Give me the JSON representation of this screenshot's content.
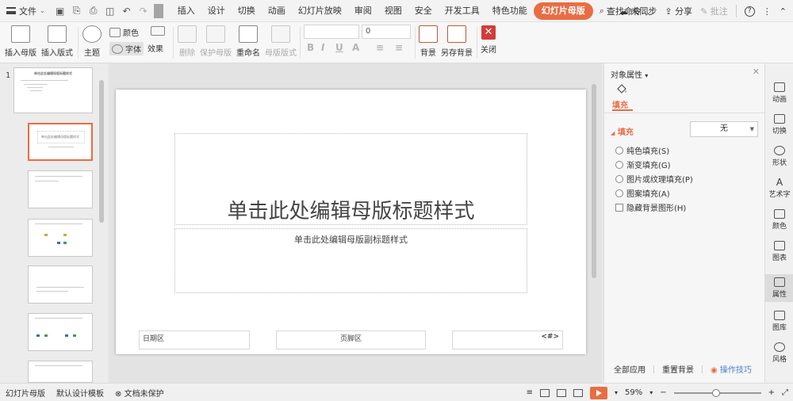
{
  "menubar": {
    "file_label": "文件",
    "tabs": [
      "插入",
      "设计",
      "切换",
      "动画",
      "幻灯片放映",
      "审阅",
      "视图",
      "安全",
      "开发工具",
      "特色功能",
      "幻灯片母版"
    ],
    "active_tab": "幻灯片母版",
    "search_label": "查找命令...",
    "sync_label": "未同步",
    "share_label": "分享",
    "annotate_label": "批注",
    "help_label": "?"
  },
  "ribbon": {
    "insert_master": "插入母版",
    "insert_layout": "插入版式",
    "theme": "主题",
    "colors": "颜色",
    "fonts": "字体",
    "effects": "效果",
    "delete": "删除",
    "protect_master": "保护母版",
    "rename": "重命名",
    "master_layout": "母版版式",
    "font_size_value": "0",
    "background": "背景",
    "save_background": "另存背景",
    "close": "关闭",
    "format_letters": [
      "B",
      "I",
      "U",
      "A",
      "≡",
      "≡"
    ]
  },
  "thumbnails": {
    "slide_number": "1",
    "master_title": "单击此处编辑母版标题样式",
    "layout_title": "单击此处编辑母版标题样式"
  },
  "slide": {
    "title": "单击此处编辑母版标题样式",
    "subtitle": "单击此处编辑母版副标题样式",
    "date_label": "日期区",
    "footer_label": "页脚区",
    "number_label": "<#>"
  },
  "properties": {
    "panel_title": "对象属性",
    "tab_fill": "填充",
    "section_fill": "填充",
    "fill_value": "无",
    "options": [
      "纯色填充(S)",
      "渐变填充(G)",
      "图片或纹理填充(P)",
      "图案填充(A)"
    ],
    "hide_bg_label": "隐藏背景图形(H)",
    "apply_all": "全部应用",
    "reset_bg": "重置背景",
    "tips": "操作技巧"
  },
  "sidebar": [
    "动画",
    "切换",
    "形状",
    "艺术字",
    "颜色",
    "图表",
    "属性",
    "图库",
    "风格"
  ],
  "sidebar_active": "属性",
  "status": {
    "mode": "幻灯片母版",
    "template": "默认设计模板",
    "protection": "文档未保护",
    "zoom": "59%",
    "zoom_level_pct": 59
  },
  "colors": {
    "accent": "#e96d43",
    "close_red": "#d33b3b"
  }
}
